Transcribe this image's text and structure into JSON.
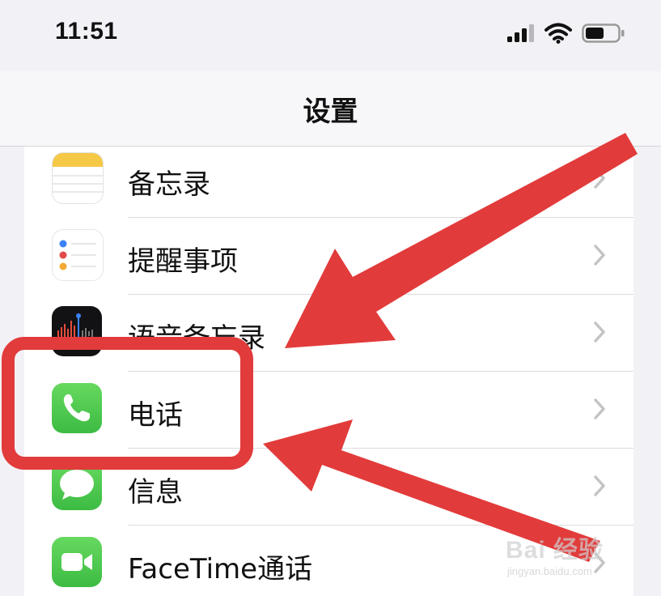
{
  "status_bar": {
    "time": "11:51",
    "icons": [
      "signal-icon",
      "wifi-icon",
      "battery-icon"
    ]
  },
  "nav": {
    "title": "设置"
  },
  "rows": [
    {
      "label": "备忘录",
      "icon": "notes-icon"
    },
    {
      "label": "提醒事项",
      "icon": "reminders-icon"
    },
    {
      "label": "语音备忘录",
      "icon": "voice-memos-icon"
    },
    {
      "label": "电话",
      "icon": "phone-icon"
    },
    {
      "label": "信息",
      "icon": "messages-icon"
    },
    {
      "label": "FaceTime通话",
      "icon": "facetime-icon"
    }
  ],
  "annotation": {
    "color": "#e23b3b"
  },
  "watermark": {
    "main": "Bai 经验",
    "sub": "jingyan.baidu.com"
  }
}
